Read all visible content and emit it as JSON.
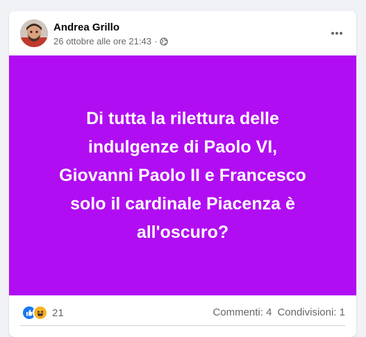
{
  "post": {
    "author": "Andrea Grillo",
    "timestamp": "26 ottobre alle ore 21:43",
    "separator": "·",
    "privacy_icon": "globe-icon",
    "more_icon": "more-options-icon",
    "image_background": "#b10df2",
    "image_text": "Di tutta la rilettura delle\nindulgenze di Paolo VI,\nGiovanni Paolo II e Francesco\nsolo il cardinale Piacenza è\nall'oscuro?"
  },
  "stats": {
    "reaction_icons": [
      "like-icon",
      "haha-icon"
    ],
    "reaction_count": "21",
    "comments": "Commenti: 4",
    "shares": "Condivisioni: 1"
  },
  "colors": {
    "page_bg": "#f0f2f5",
    "card_bg": "#ffffff",
    "secondary_text": "#65676b",
    "like_blue": "#1877f2",
    "haha_yellow": "#f7b125"
  }
}
